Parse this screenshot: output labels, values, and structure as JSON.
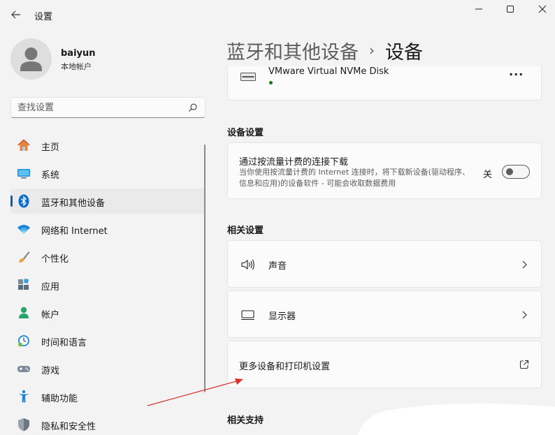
{
  "window": {
    "title": "设置",
    "controls": {
      "minimize": "minimize",
      "maximize": "maximize",
      "close": "close"
    }
  },
  "profile": {
    "name": "baiyun",
    "account": "本地帐户"
  },
  "search": {
    "placeholder": "查找设置"
  },
  "nav": {
    "items": [
      {
        "label": "主页",
        "icon": "home-icon",
        "active": false
      },
      {
        "label": "系统",
        "icon": "system-icon",
        "active": false
      },
      {
        "label": "蓝牙和其他设备",
        "icon": "bluetooth-icon",
        "active": true
      },
      {
        "label": "网络和 Internet",
        "icon": "wifi-icon",
        "active": false
      },
      {
        "label": "个性化",
        "icon": "brush-icon",
        "active": false
      },
      {
        "label": "应用",
        "icon": "apps-icon",
        "active": false
      },
      {
        "label": "帐户",
        "icon": "account-icon",
        "active": false
      },
      {
        "label": "时间和语言",
        "icon": "clock-globe-icon",
        "active": false
      },
      {
        "label": "游戏",
        "icon": "gamepad-icon",
        "active": false
      },
      {
        "label": "辅助功能",
        "icon": "accessibility-icon",
        "active": false
      },
      {
        "label": "隐私和安全性",
        "icon": "shield-icon",
        "active": false
      }
    ]
  },
  "header": {
    "parent": "蓝牙和其他设备",
    "separator": "›",
    "current": "设备"
  },
  "device": {
    "name": "VMware Virtual NVMe Disk",
    "more": "···"
  },
  "sections": {
    "device_settings": "设备设置",
    "related_settings": "相关设置",
    "related_support": "相关支持"
  },
  "metered": {
    "title": "通过按流量计费的连接下载",
    "description": "当你使用按流量计费的 Internet 连接时，将下载新设备(驱动程序、信息和应用)的设备软件 - 可能会收取数据费用",
    "toggle_state": "关"
  },
  "related": {
    "sound": "声音",
    "display": "显示器",
    "more_devices": "更多设备和打印机设置"
  },
  "colors": {
    "accent": "#005fb8",
    "annotation_arrow": "#d9342b",
    "status_green": "#0f7b0f"
  }
}
